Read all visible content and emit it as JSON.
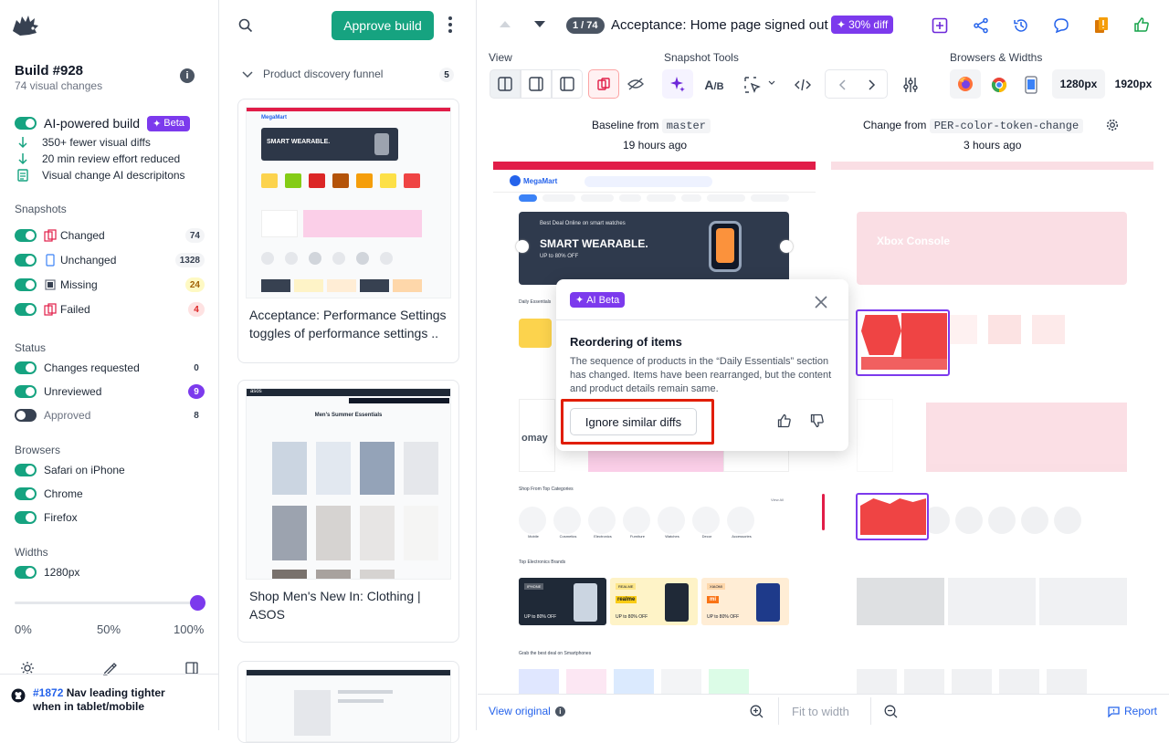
{
  "sidebar": {
    "build_title": "Build #928",
    "build_sub": "74 visual changes",
    "ai_label": "AI-powered build",
    "beta": "Beta",
    "ai_lines": [
      "350+ fewer visual diffs",
      "20 min review effort reduced",
      "Visual change AI descripitons"
    ],
    "snapshots_title": "Snapshots",
    "snapshots": [
      {
        "label": "Changed",
        "count": "74"
      },
      {
        "label": "Unchanged",
        "count": "1328"
      },
      {
        "label": "Missing",
        "count": "24"
      },
      {
        "label": "Failed",
        "count": "4"
      }
    ],
    "status_title": "Status",
    "status": [
      {
        "label": "Changes requested",
        "count": "0"
      },
      {
        "label": "Unreviewed",
        "count": "9"
      },
      {
        "label": "Approved",
        "count": "8"
      }
    ],
    "browsers_title": "Browsers",
    "browsers": [
      "Safari on iPhone",
      "Chrome",
      "Firefox"
    ],
    "widths_title": "Widths",
    "widths": [
      "1280px"
    ],
    "slider": {
      "min": "0%",
      "mid": "50%",
      "max": "100%",
      "value": 1.0
    },
    "pr": {
      "number": "#1872",
      "text": " Nav leading tighter when in tablet/mobile"
    }
  },
  "middle": {
    "approve": "Approve build",
    "group": "Product discovery funnel",
    "group_count": "5",
    "cards": [
      {
        "title": "Acceptance: Performance Settings toggles of performance settings ..",
        "shop": "MegaMart",
        "banner": "SMART WEARABLE."
      },
      {
        "title": "Shop Men's New In: Clothing | ASOS",
        "shop": "asos",
        "banner": "Men's Summer Essentials"
      }
    ]
  },
  "header": {
    "counter": "1 / 74",
    "title": "Acceptance: Home page signed out ..",
    "diff_badge": "30% diff"
  },
  "toolbar": {
    "view_label": "View",
    "tools_label": "Snapshot Tools",
    "browsers_label": "Browsers & Widths",
    "widths": [
      "1280px",
      "1920px"
    ]
  },
  "compare": {
    "baseline_label": "Baseline from",
    "baseline_branch": "master",
    "baseline_time": "19 hours ago",
    "change_label": "Change from",
    "change_branch": "PER-color-token-change",
    "change_time": "3 hours ago"
  },
  "shop": {
    "brand": "MegaMart",
    "hero_small": "Best Deal Online on smart watches",
    "hero": "SMART WEARABLE.",
    "hero_sub": "UP to 80% OFF",
    "daily": "Daily Essentials",
    "cat_title": "Shop From Top Categories",
    "categories": [
      "Mobile",
      "Cosmetics",
      "Electronics",
      "Furniture",
      "Watches",
      "Decor",
      "Accessories"
    ],
    "brands_title": "Top Electronics Brands",
    "brands": [
      {
        "name": "IPHONE",
        "logo": "",
        "off": "UP to 80% OFF",
        "bg": "#1f2937",
        "fg": "#ffffff"
      },
      {
        "name": "REALME",
        "logo": "realme",
        "off": "UP to 80% OFF",
        "bg": "#fef3c7",
        "fg": "#111827"
      },
      {
        "name": "XIAOMI",
        "logo": "mi",
        "off": "UP to 80% OFF",
        "bg": "#ffedd5",
        "fg": "#111827"
      }
    ],
    "deal_title": "Grab the best deal on Smartphones",
    "view_all": "View All",
    "omay": "omay",
    "changed_hero": "Xbox Console"
  },
  "popup": {
    "badge": "AI Beta",
    "title": "Reordering of items",
    "body": "The sequence of products in the “Daily Essentials” section has changed. Items have been rearranged, but the content and product details remain same.",
    "button": "Ignore similar diffs"
  },
  "footer": {
    "view_original": "View original",
    "fit": "Fit to width",
    "report": "Report"
  },
  "colors": {
    "accent": "#16a380",
    "purple": "#7c3aed",
    "diff": "#e11d48"
  }
}
